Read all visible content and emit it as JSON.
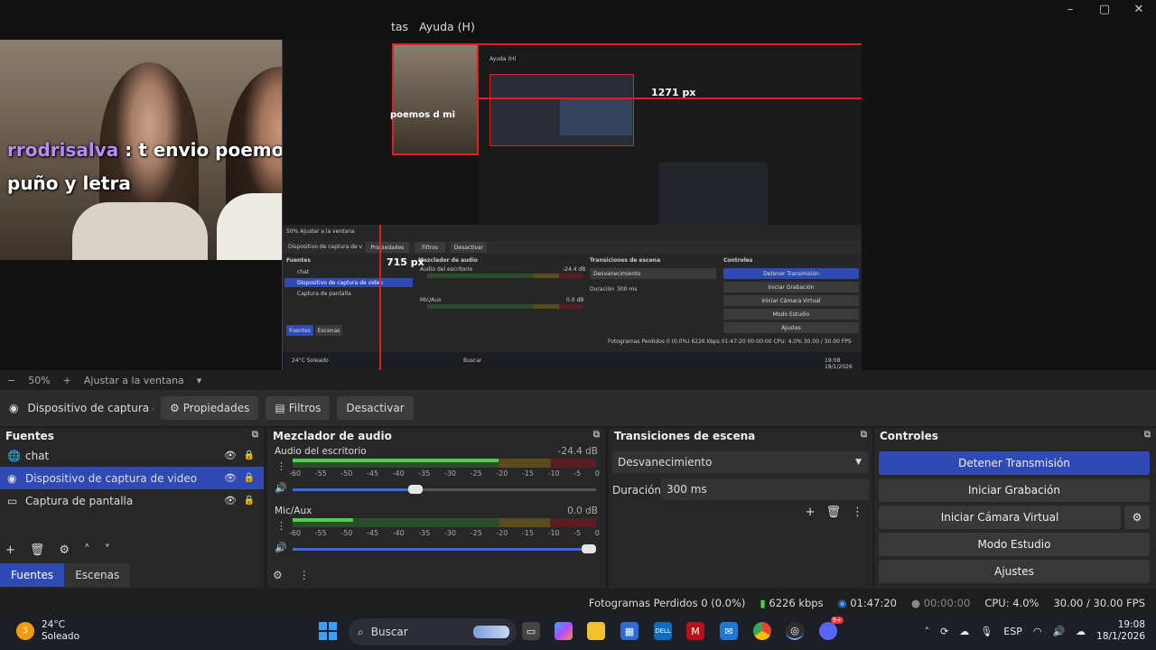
{
  "menu": {
    "partial_item": "tas",
    "help": "Ayuda (H)"
  },
  "window_controls": {
    "minimize": "–",
    "maximize": "▢",
    "close": "✕"
  },
  "chat_overlay": {
    "user": "rrodrisalva",
    "message": " : t envio poemos d mi puño y letra"
  },
  "nested_preview": {
    "width_label": "1271 px",
    "height_label": "715 px",
    "mini_help": "Ayuda (H)",
    "mini_chat": "poemos d mi",
    "mini_sources": [
      "chat",
      "Dispositivo de captura de video",
      "Captura de pantalla"
    ],
    "mini_controls": [
      "Detener Transmisión",
      "Iniciar Grabación",
      "Iniciar Cámara Virtual",
      "Modo Estudio",
      "Ajustes"
    ],
    "mini_titles": {
      "sources": "Fuentes",
      "mixer": "Mezclador de audio",
      "trans": "Transiciones de escena",
      "controls": "Controles"
    },
    "mini_status": "Fotogramas Perdidos 0 (0.0%)   6226 kbps   01:47:20   00:00:00   CPU: 4.0%   30.00 / 30.00 FPS",
    "mini_tabs": [
      "Fuentes",
      "Escenas"
    ],
    "mini_srcbar": [
      "Dispositivo de captura de v",
      "Propiedades",
      "Filtros",
      "Desactivar"
    ],
    "mini_zoom": "50%   Ajustar a la ventana",
    "mini_trans": "Desvanecimiento",
    "mini_duration": "Duración",
    "mini_duration_val": "300 ms",
    "mini_mixer": [
      "Audio del escritorio",
      "Mic/Aux"
    ],
    "mini_db": [
      "-24.4 dB",
      "0.0 dB"
    ],
    "mini_weather": "24°C Soleado",
    "mini_search": "Buscar",
    "mini_clock": "19:08 18/1/2026"
  },
  "zoom": {
    "minus": "−",
    "level": "50%",
    "plus": "+",
    "fit": "Ajustar a la ventana",
    "caret": "▾"
  },
  "source_bar": {
    "name": "Dispositivo de captura de v",
    "properties": "Propiedades",
    "filters": "Filtros",
    "disable": "Desactivar"
  },
  "sources": {
    "title": "Fuentes",
    "items": [
      {
        "label": "chat",
        "icon": "globe-icon",
        "selected": false
      },
      {
        "label": "Dispositivo de captura de video",
        "icon": "camera-icon",
        "selected": true
      },
      {
        "label": "Captura de pantalla",
        "icon": "monitor-icon",
        "selected": false
      }
    ],
    "tabs": [
      "Fuentes",
      "Escenas"
    ]
  },
  "mixer": {
    "title": "Mezclador de audio",
    "channels": [
      {
        "name": "Audio del escritorio",
        "db": "-24.4 dB",
        "level": 0.68,
        "volume": 0.43
      },
      {
        "name": "Mic/Aux",
        "db": "0.0 dB",
        "level": 0.2,
        "volume": 1.0
      }
    ],
    "ticks": [
      "-60",
      "-55",
      "-50",
      "-45",
      "-40",
      "-35",
      "-30",
      "-25",
      "-20",
      "-15",
      "-10",
      "-5",
      "0"
    ]
  },
  "transitions": {
    "title": "Transiciones de escena",
    "selected": "Desvanecimiento",
    "duration_label": "Duración",
    "duration_value": "300 ms"
  },
  "controls": {
    "title": "Controles",
    "stop_stream": "Detener Transmisión",
    "start_recording": "Iniciar Grabación",
    "start_virtual_cam": "Iniciar Cámara Virtual",
    "studio_mode": "Modo Estudio",
    "settings": "Ajustes"
  },
  "status": {
    "dropped_frames": "Fotogramas Perdidos 0 (0.0%)",
    "kbps": "6226 kbps",
    "stream_time": "01:47:20",
    "record_time": "00:00:00",
    "cpu": "CPU: 4.0%",
    "fps": "30.00 / 30.00 FPS"
  },
  "taskbar": {
    "weather_badge": "3",
    "temp": "24°C",
    "condition": "Soleado",
    "search": "Buscar",
    "lang": "ESP",
    "time": "19:08",
    "date": "18/1/2026",
    "discord_badge": "9+"
  },
  "colors": {
    "accent": "#2f4bb3",
    "chat_user": "#b88bff",
    "stream_green": "#4ad34a",
    "guide_red": "#e02020"
  }
}
